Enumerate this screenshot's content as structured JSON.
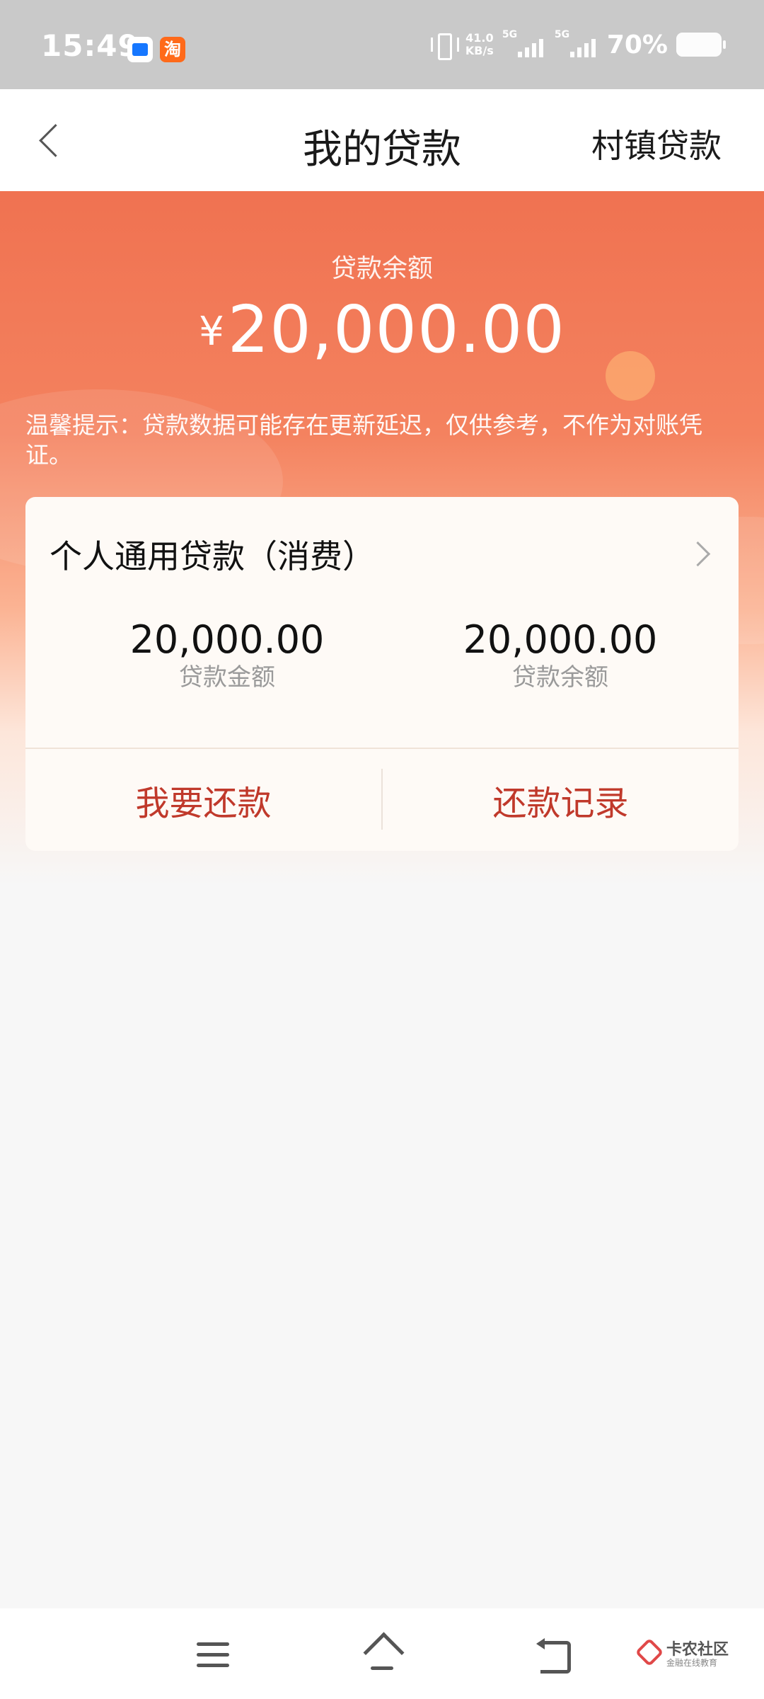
{
  "status_bar": {
    "time": "15:49",
    "app_icons": [
      "alipay-icon",
      "taobao-icon"
    ],
    "taobao_glyph": "淘",
    "net_speed_value": "41.0",
    "net_speed_unit": "KB/s",
    "signal1_label": "5G",
    "signal2_label": "5G",
    "battery": "70%",
    "battery_level": 0.7
  },
  "header": {
    "title": "我的贷款",
    "right_action": "村镇贷款",
    "back_icon": "chevron-left-icon"
  },
  "hero": {
    "balance_label": "贷款余额",
    "currency_symbol": "¥",
    "balance_amount": "20,000.00",
    "notice": "温馨提示：贷款数据可能存在更新延迟，仅供参考，不作为对账凭证。",
    "background_color": "#f07251"
  },
  "loan_card": {
    "title": "个人通用贷款（消费）",
    "loan_amount_value": "20,000.00",
    "loan_amount_label": "贷款金额",
    "loan_balance_value": "20,000.00",
    "loan_balance_label": "贷款余额",
    "repay_button": "我要还款",
    "records_button": "还款记录",
    "accent_color": "#c0392b"
  },
  "nav_bar": {
    "icons": [
      "menu-icon",
      "home-icon",
      "back-icon"
    ]
  },
  "watermark": {
    "title": "卡农社区",
    "subtitle": "金融在线教育"
  }
}
